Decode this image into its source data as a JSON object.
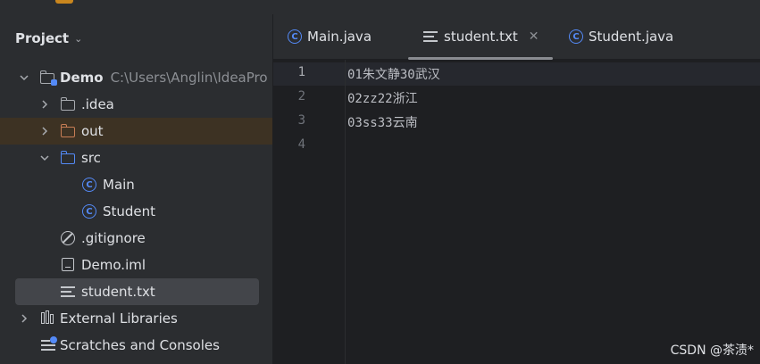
{
  "project_panel": {
    "title": "Project",
    "items": [
      {
        "label": "Demo",
        "path": "C:\\Users\\Anglin\\IdeaPro",
        "icon": "module-folder-icon"
      },
      {
        "label": ".idea",
        "icon": "folder-icon"
      },
      {
        "label": "out",
        "icon": "folder-icon"
      },
      {
        "label": "src",
        "icon": "folder-icon"
      },
      {
        "label": "Main",
        "icon": "class-icon"
      },
      {
        "label": "Student",
        "icon": "class-icon"
      },
      {
        "label": ".gitignore",
        "icon": "ignore-file-icon"
      },
      {
        "label": "Demo.iml",
        "icon": "iml-file-icon"
      },
      {
        "label": "student.txt",
        "icon": "text-file-icon"
      },
      {
        "label": "External Libraries",
        "icon": "libraries-icon"
      },
      {
        "label": "Scratches and Consoles",
        "icon": "scratches-icon"
      }
    ]
  },
  "editor": {
    "tabs": [
      {
        "label": "Main.java",
        "icon": "class-icon"
      },
      {
        "label": "student.txt",
        "icon": "text-file-icon",
        "active": true
      },
      {
        "label": "Student.java",
        "icon": "class-icon"
      }
    ],
    "line_numbers": [
      "1",
      "2",
      "3",
      "4"
    ],
    "lines": [
      "01朱文静30武汉",
      "02zz22浙江",
      "03ss33云南",
      ""
    ]
  },
  "watermark": "CSDN @茶渍*",
  "colors": {
    "panel_bg": "#2b2d30",
    "editor_bg": "#1e1f22",
    "selection": "#43454a",
    "accent_blue": "#548af7",
    "excluded_folder": "#c77d55"
  }
}
